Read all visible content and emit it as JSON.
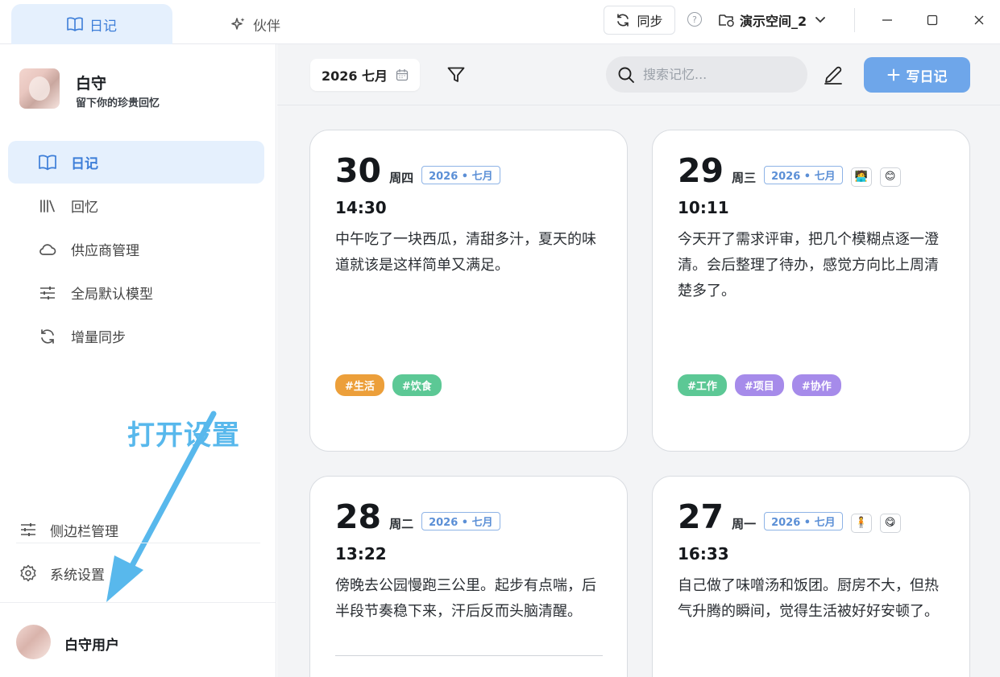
{
  "titlebar": {
    "tabs": [
      {
        "label": "日记",
        "active": true
      },
      {
        "label": "伙伴",
        "active": false
      }
    ],
    "sync_label": "同步",
    "help_glyph": "?",
    "workspace_label": "演示空间_2"
  },
  "sidebar": {
    "profile_name": "白守",
    "profile_subtitle": "留下你的珍贵回忆",
    "nav": [
      {
        "label": "日记",
        "icon": "book-icon",
        "active": true
      },
      {
        "label": "回忆",
        "icon": "library-icon",
        "active": false
      },
      {
        "label": "供应商管理",
        "icon": "cloud-icon",
        "active": false
      },
      {
        "label": "全局默认模型",
        "icon": "sliders-icon",
        "active": false
      },
      {
        "label": "增量同步",
        "icon": "refresh-icon",
        "active": false
      }
    ],
    "annotation": "打开设置",
    "bottom": [
      {
        "label": "侧边栏管理",
        "icon": "sliders-icon"
      },
      {
        "label": "系统设置",
        "icon": "gear-icon"
      }
    ],
    "user_name": "白守用户"
  },
  "toolbar": {
    "date_label": "2026 七月",
    "search_placeholder": "搜索记忆...",
    "write_label": "写日记"
  },
  "colors": {
    "accent": "#3d7ed8",
    "primary_button": "#6ea6ea",
    "annotation": "#58b8ec",
    "tag_orange": "#ec9f3a",
    "tag_green": "#5cc895",
    "tag_purple": "#a68bea"
  },
  "cards": [
    {
      "day": "30",
      "weekday": "周四",
      "badge": "2026 • 七月",
      "time": "14:30",
      "text": "中午吃了一块西瓜，清甜多汁，夏天的味道就该是这样简单又满足。",
      "emojis": [],
      "tags": [
        {
          "label": "#生活",
          "color": "#ec9f3a"
        },
        {
          "label": "#饮食",
          "color": "#5cc895"
        }
      ]
    },
    {
      "day": "29",
      "weekday": "周三",
      "badge": "2026 • 七月",
      "time": "10:11",
      "text": "今天开了需求评审，把几个模糊点逐一澄清。会后整理了待办，感觉方向比上周清楚多了。",
      "emojis": [
        "🧑‍💻",
        "😊"
      ],
      "tags": [
        {
          "label": "#工作",
          "color": "#5cc895"
        },
        {
          "label": "#项目",
          "color": "#a68bea"
        },
        {
          "label": "#协作",
          "color": "#a68bea"
        }
      ]
    },
    {
      "day": "28",
      "weekday": "周二",
      "badge": "2026 • 七月",
      "time": "13:22",
      "text": "傍晚去公园慢跑三公里。起步有点喘，后半段节奏稳下来，汗后反而头脑清醒。",
      "emojis": [],
      "tags": []
    },
    {
      "day": "27",
      "weekday": "周一",
      "badge": "2026 • 七月",
      "time": "16:33",
      "text": "自己做了味噌汤和饭团。厨房不大，但热气升腾的瞬间，觉得生活被好好安顿了。",
      "emojis": [
        "🧍",
        "😋"
      ],
      "tags": []
    }
  ]
}
